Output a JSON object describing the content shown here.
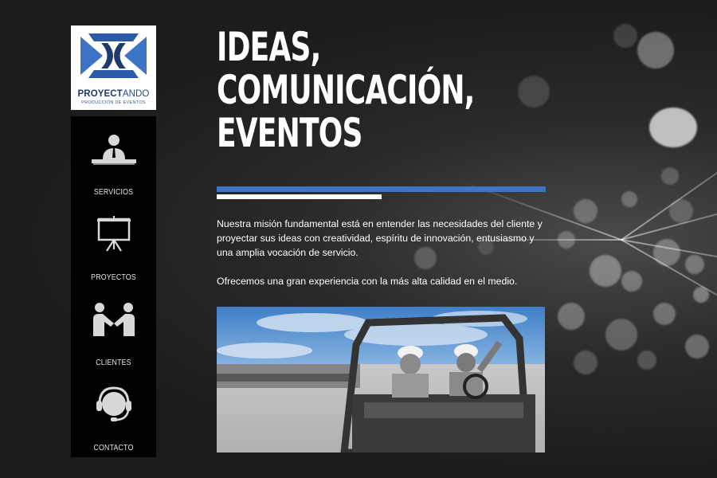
{
  "logo": {
    "name_bold": "PROYECT",
    "name_light": "ANDO",
    "tagline": "PRODUCCIÓN DE EVENTOS"
  },
  "nav": {
    "items": [
      {
        "label": "SERVICIOS",
        "icon": "presenter-desk-icon"
      },
      {
        "label": "PROYECTOS",
        "icon": "projector-screen-icon"
      },
      {
        "label": "CLIENTES",
        "icon": "handshake-icon"
      },
      {
        "label": "CONTACTO",
        "icon": "headset-icon"
      }
    ]
  },
  "hero": {
    "headline": [
      "IDEAS,",
      "COMUNICACIÓN,",
      "EVENTOS"
    ]
  },
  "content": {
    "paragraph1": "Nuestra misión fundamental está en entender las necesidades del cliente y proyectar sus ideas con creatividad, espíritu de innovación, entusiasmo y una amplia vocación de servicio.",
    "paragraph2": "Ofrecemos una gran experiencia con la más alta calidad en el medio."
  },
  "colors": {
    "accent_blue": "#3d74c5",
    "logo_navy": "#1d3c6e",
    "nav_bg": "#000000"
  }
}
